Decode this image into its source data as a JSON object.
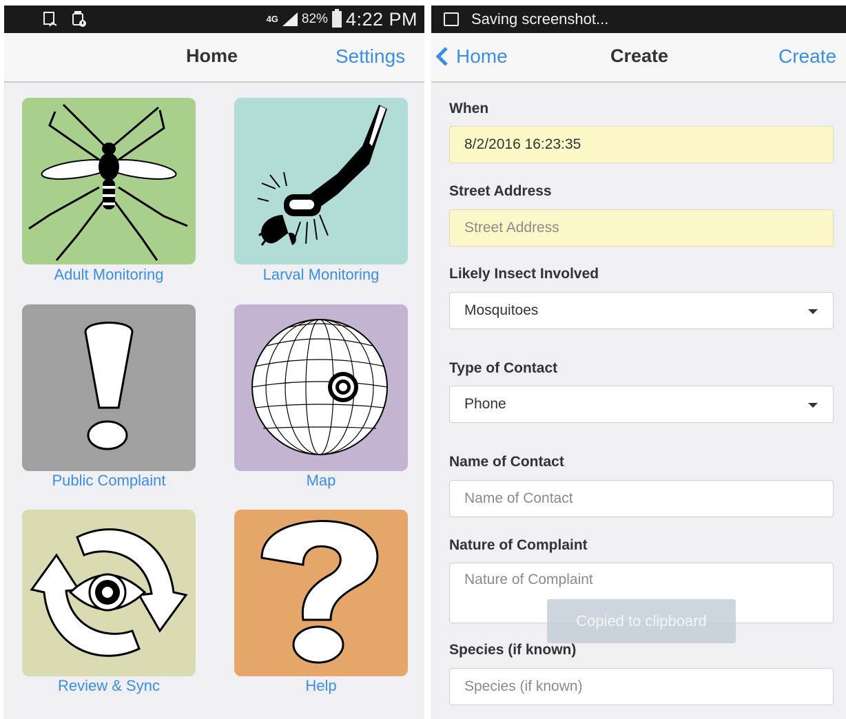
{
  "left_screen": {
    "status_bar": {
      "network": "4G",
      "battery": "82%",
      "time": "4:22 PM"
    },
    "nav": {
      "title": "Home",
      "settings_link": "Settings"
    },
    "tiles": [
      {
        "label": "Adult Monitoring",
        "icon": "mosquito-icon",
        "color": "#a9cf8c"
      },
      {
        "label": "Larval Monitoring",
        "icon": "larva-icon",
        "color": "#b2ddd7"
      },
      {
        "label": "Public Complaint",
        "icon": "exclamation-icon",
        "color": "#a0a0a0"
      },
      {
        "label": "Map",
        "icon": "globe-target-icon",
        "color": "#c3b5d1"
      },
      {
        "label": "Review & Sync",
        "icon": "eye-sync-icon",
        "color": "#dadbb2"
      },
      {
        "label": "Help",
        "icon": "question-icon",
        "color": "#e5a66a"
      }
    ]
  },
  "right_screen": {
    "status_bar": {
      "notification": "Saving screenshot..."
    },
    "nav": {
      "back_label": "Home",
      "title": "Create",
      "action_label": "Create"
    },
    "form": {
      "when": {
        "label": "When",
        "value": "8/2/2016 16:23:35"
      },
      "street_address": {
        "label": "Street Address",
        "placeholder": "Street Address"
      },
      "insect": {
        "label": "Likely Insect Involved",
        "value": "Mosquitoes"
      },
      "contact_type": {
        "label": "Type of Contact",
        "value": "Phone"
      },
      "contact_name": {
        "label": "Name of Contact",
        "placeholder": "Name of Contact"
      },
      "complaint": {
        "label": "Nature of Complaint",
        "placeholder": "Nature of Complaint"
      },
      "species": {
        "label": "Species (if known)",
        "placeholder": "Species (if known)"
      }
    },
    "toast": "Copied to clipboard"
  },
  "colors": {
    "link": "#3a8ee6",
    "statusbar": "#1a1a1a",
    "background": "#efeff4"
  }
}
